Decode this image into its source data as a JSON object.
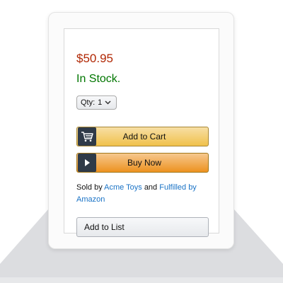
{
  "product": {
    "price": "$50.95",
    "stock_status": "In Stock.",
    "quantity": {
      "label": "Qty:",
      "selected": "1"
    },
    "add_to_cart_label": "Add to Cart",
    "buy_now_label": "Buy Now",
    "seller": {
      "sold_by_prefix": "Sold by",
      "seller_name": "Acme Toys",
      "conjunction": "and",
      "fulfilled_by_link": "Fulfilled by",
      "fulfiller_name": "Amazon"
    },
    "add_to_list_label": "Add to List"
  },
  "colors": {
    "price": "#b12704",
    "stock": "#007600",
    "link": "#1a73c6",
    "cart_button": "#f0c14b",
    "buy_button": "#ed9220",
    "icon_tile": "#2f3a48"
  },
  "icons": {
    "cart": "cart-icon",
    "buy": "play-icon",
    "qty_dropdown": "chevron-down-icon"
  }
}
